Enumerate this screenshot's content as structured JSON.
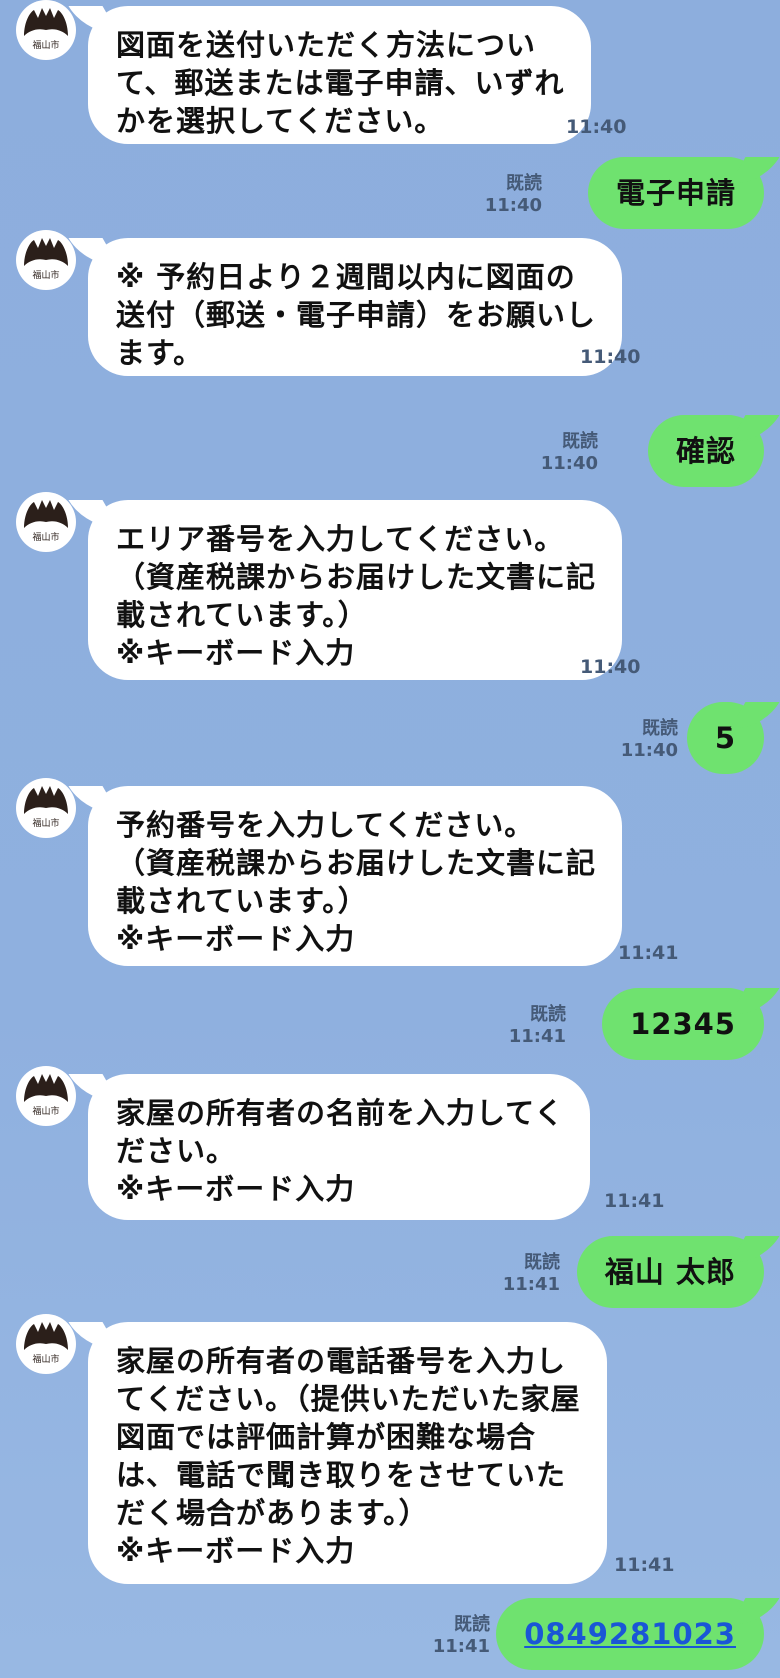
{
  "avatar": {
    "label": "福山市"
  },
  "messages": [
    {
      "dir": "in",
      "lines": [
        "図面を送付いただく方法につい",
        "て、郵送または電子申請、いずれ",
        "かを選択してください。"
      ],
      "time": "11:40"
    },
    {
      "dir": "out",
      "text": "電子申請",
      "read": "既読",
      "time": "11:40"
    },
    {
      "dir": "in",
      "lines": [
        "※ 予約日より２週間以内に図面の",
        "送付（郵送・電子申請）をお願いし",
        "ます。"
      ],
      "time": "11:40"
    },
    {
      "dir": "out",
      "text": "確認",
      "read": "既読",
      "time": "11:40"
    },
    {
      "dir": "in",
      "lines": [
        "エリア番号を入力してください。",
        "（資産税課からお届けした文書に記",
        "載されています。）",
        "※キーボード入力"
      ],
      "time": "11:40"
    },
    {
      "dir": "out",
      "text": "5",
      "read": "既読",
      "time": "11:40"
    },
    {
      "dir": "in",
      "lines": [
        "予約番号を入力してください。",
        "（資産税課からお届けした文書に記",
        "載されています。）",
        "※キーボード入力"
      ],
      "time": "11:41"
    },
    {
      "dir": "out",
      "text": "12345",
      "read": "既読",
      "time": "11:41"
    },
    {
      "dir": "in",
      "lines": [
        "家屋の所有者の名前を入力してく",
        "ださい。",
        "※キーボード入力"
      ],
      "time": "11:41"
    },
    {
      "dir": "out",
      "text": "福山  太郎",
      "read": "既読",
      "time": "11:41"
    },
    {
      "dir": "in",
      "lines": [
        "家屋の所有者の電話番号を入力し",
        "てください。（提供いただいた家屋",
        "図面では評価計算が困難な場合",
        "は、電話で聞き取りをさせていた",
        "だく場合があります。）",
        "※キーボード入力"
      ],
      "time": "11:41"
    },
    {
      "dir": "out",
      "text": "0849281023",
      "read": "既読",
      "time": "11:41",
      "link": true
    }
  ],
  "colors": {
    "background": "#8fb0df",
    "incoming_bubble": "#ffffff",
    "outgoing_bubble": "#6fe26f",
    "link": "#1a56d6",
    "avatar_mark": "#2b1f1a"
  },
  "icons": {
    "avatar": "fukuyama-city-emblem-icon"
  }
}
